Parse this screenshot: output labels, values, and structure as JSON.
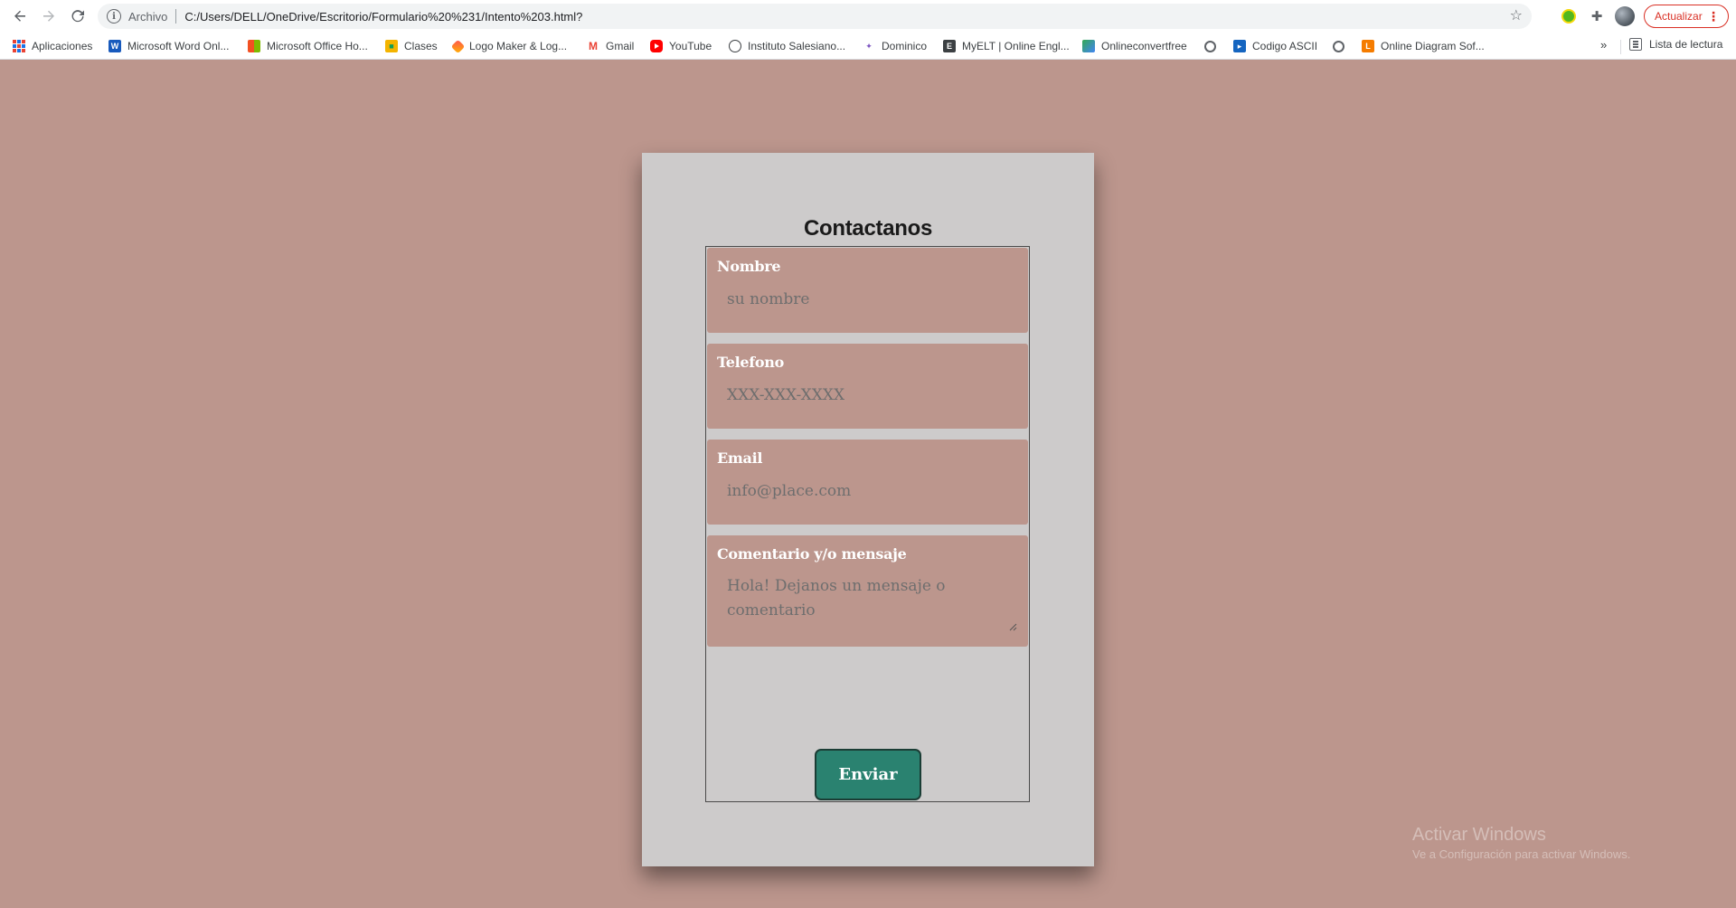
{
  "browser": {
    "url_scheme": "Archivo",
    "url": "C:/Users/DELL/OneDrive/Escritorio/Formulario%20%231/Intento%203.html?",
    "update_label": "Actualizar",
    "more_bookmarks": "»",
    "reading_list": "Lista de lectura",
    "bookmarks": [
      {
        "label": "Aplicaciones",
        "icon": "apps-icon"
      },
      {
        "label": "Microsoft Word Onl...",
        "icon": "word-icon"
      },
      {
        "label": "Microsoft Office Ho...",
        "icon": "office-icon"
      },
      {
        "label": "Clases",
        "icon": "classroom-icon"
      },
      {
        "label": "Logo Maker & Log...",
        "icon": "logo-maker-icon"
      },
      {
        "label": "Gmail",
        "icon": "gmail-icon"
      },
      {
        "label": "YouTube",
        "icon": "youtube-icon"
      },
      {
        "label": "Instituto Salesiano...",
        "icon": "salesiano-icon"
      },
      {
        "label": "Dominico",
        "icon": "dominico-icon"
      },
      {
        "label": "MyELT | Online Engl...",
        "icon": "myelt-icon"
      },
      {
        "label": "Onlineconvertfree",
        "icon": "convert-icon"
      },
      {
        "label": "",
        "icon": "globe-icon"
      },
      {
        "label": "Codigo ASCII",
        "icon": "ascii-icon"
      },
      {
        "label": "",
        "icon": "globe-icon"
      },
      {
        "label": "Online Diagram Sof...",
        "icon": "diagram-icon"
      }
    ]
  },
  "form": {
    "title": "Contactanos",
    "fields": [
      {
        "label": "Nombre",
        "placeholder": "su nombre"
      },
      {
        "label": "Telefono",
        "placeholder": "XXX-XXX-XXXX"
      },
      {
        "label": "Email",
        "placeholder": "info@place.com"
      },
      {
        "label": "Comentario y/o mensaje",
        "placeholder": "Hola! Dejanos un mensaje o comentario"
      }
    ],
    "submit_label": "Enviar"
  },
  "watermark": {
    "title": "Activar Windows",
    "subtitle": "Ve a Configuración para activar Windows."
  },
  "colors": {
    "page_background": "#bc968d",
    "card_background": "#cdcbcb",
    "field_background": "#bc968d",
    "submit_button": "#2a8270",
    "update_accent": "#d93025"
  }
}
